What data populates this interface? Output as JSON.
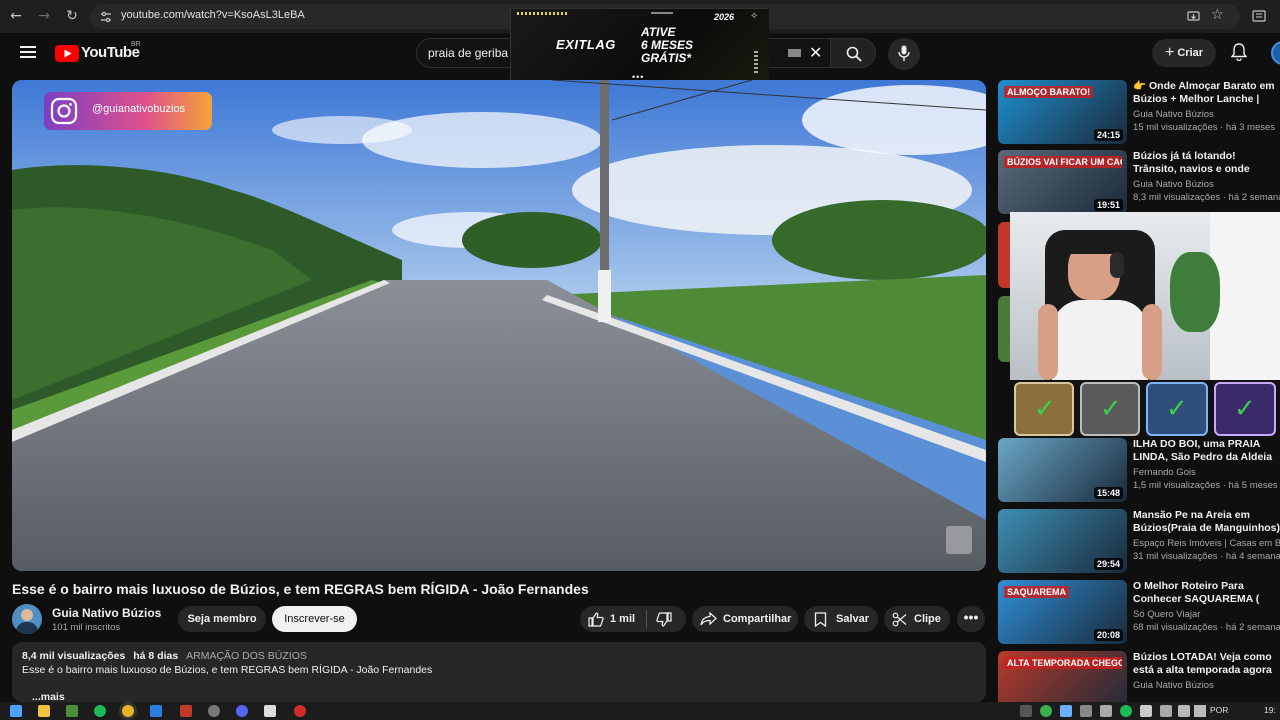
{
  "browser": {
    "url": "youtube.com/watch?v=KsoAsL3LeBA"
  },
  "header": {
    "logo_text": "YouTube",
    "region": "BR",
    "search_value": "praia de geriba",
    "create_label": "Criar"
  },
  "ad": {
    "brand": "EXITLAG",
    "line1": "ATIVE",
    "line2": "6 MESES",
    "line3": "GRÁTIS*",
    "badge": "2026"
  },
  "player": {
    "instagram_handle": "@guianativobuzios"
  },
  "video": {
    "title": "Esse é o bairro mais luxuoso de Búzios, e tem REGRAS bem RÍGIDA - João Fernandes",
    "channel": "Guia Nativo Búzios",
    "subscribers": "101 mil inscritos",
    "member_label": "Seja membro",
    "subscribe_label": "Inscrever-se",
    "likes": "1 mil",
    "share_label": "Compartilhar",
    "save_label": "Salvar",
    "clip_label": "Clipe",
    "views": "8,4 mil visualizações",
    "age": "há 8 dias",
    "location_tag": "ARMAÇÃO DOS BÚZIOS",
    "description": "Esse é o bairro mais luxuoso de Búzios, e tem REGRAS bem RÍGIDA - João Fernandes",
    "more_label": "...mais"
  },
  "recommendations": [
    {
      "title": "👉 Onde Almoçar Barato em Búzios + Melhor Lanche | Rua ...",
      "channel": "Guia Nativo Búzios",
      "meta": "15 mil visualizações · há 3 meses",
      "duration": "24:15",
      "thumb_text": "ALMOÇO BARATO!",
      "thumb_color": "#1e8fd0"
    },
    {
      "title": "Búzios já tá lotando! Trânsito, navios e onde almoçar barato",
      "channel": "Guia Nativo Búzios",
      "meta": "8,3 mil visualizações · há 2 semanas",
      "duration": "19:51",
      "thumb_text": "BÚZIOS VAI FICAR UM CAOS!",
      "thumb_color": "#5a6a7a"
    },
    {
      "title": "ILHA DO BOI, uma PRAIA LINDA, São Pedro da Aldeia R...",
      "channel": "Fernando Gois",
      "meta": "1,5 mil visualizações · há 5 meses",
      "duration": "15:48",
      "thumb_text": "",
      "thumb_color": "#6aa7c8"
    },
    {
      "title": "Mansão Pe na Areia em Búzios(Praia de Manguinhos) ...",
      "channel": "Espaço Reis Imóveis | Casas em Bú...",
      "meta": "31 mil visualizações · há 4 semanas",
      "duration": "29:54",
      "thumb_text": "",
      "thumb_color": "#3d8fb5"
    },
    {
      "title": "O Melhor Roteiro Para Conhecer SAQUAREMA ( Mais Natal Luz...",
      "channel": "Só Quero Viajar",
      "meta": "68 mil visualizações · há 2 semanas",
      "duration": "20:08",
      "thumb_text": "SAQUAREMA",
      "thumb_color": "#2f8fd8"
    },
    {
      "title": "Búzios LOTADA! Veja como está a alta temporada agora",
      "channel": "Guia Nativo Búzios",
      "meta": "",
      "duration": "",
      "thumb_text": "ALTA TEMPORADA CHEGOU!",
      "thumb_color": "#b83a2a"
    }
  ],
  "taskbar": {
    "language": "POR",
    "time": "19:"
  }
}
